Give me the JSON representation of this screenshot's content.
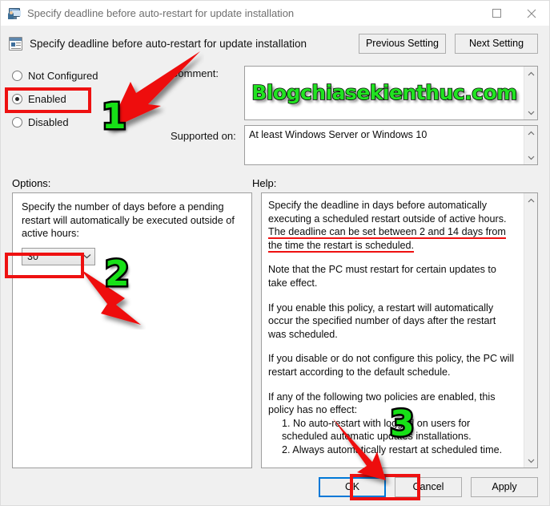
{
  "window": {
    "title": "Specify deadline before auto-restart for update installation",
    "titlebar_icon": "policy-monitor-user-icon",
    "buttons": {
      "maximize": "maximize-icon",
      "close": "close-icon"
    }
  },
  "header": {
    "policy_icon": "group-policy-setting-icon",
    "policy_title": "Specify deadline before auto-restart for update installation",
    "previous_setting": "Previous Setting",
    "next_setting": "Next Setting"
  },
  "state_options": [
    {
      "label": "Not Configured",
      "checked": false
    },
    {
      "label": "Enabled",
      "checked": true
    },
    {
      "label": "Disabled",
      "checked": false
    }
  ],
  "fields": {
    "comment_label": "Comment:",
    "comment_value": "",
    "comment_watermark": "Blogchiasekienthuc.com",
    "supported_label": "Supported on:",
    "supported_value": "At least Windows Server or Windows 10"
  },
  "sections": {
    "options_label": "Options:",
    "help_label": "Help:"
  },
  "options": {
    "prompt": "Specify the number of days before a pending restart will automatically be executed outside of active hours:",
    "days_value": "30",
    "days_chevron": "chevron-down-icon"
  },
  "help": {
    "para1_a": "Specify the deadline in days before automatically executing a scheduled restart outside of active hours. ",
    "para1_highlight": "The deadline can be set between 2 and 14 days from the time the restart is scheduled.",
    "para2": "Note that the PC must restart for certain updates to take effect.",
    "para3": "If you enable this policy, a restart will automatically occur the specified number of days after the restart was scheduled.",
    "para4": "If you disable or do not configure this policy, the PC will restart according to the default schedule.",
    "para5": "If any of the following two policies are enabled, this policy has no effect:",
    "item1": "1. No auto-restart with logged on users for scheduled automatic updates installations.",
    "item2": "2. Always automatically restart at scheduled time."
  },
  "footer": {
    "ok": "OK",
    "cancel": "Cancel",
    "apply": "Apply"
  },
  "annotations": {
    "step1": "1",
    "step2": "2",
    "step3": "3",
    "highlight_color": "#ee1111",
    "number_color": "#17e017"
  },
  "scrollbar": {
    "up_arrow": "chevron-up-icon",
    "down_arrow": "chevron-down-icon"
  }
}
